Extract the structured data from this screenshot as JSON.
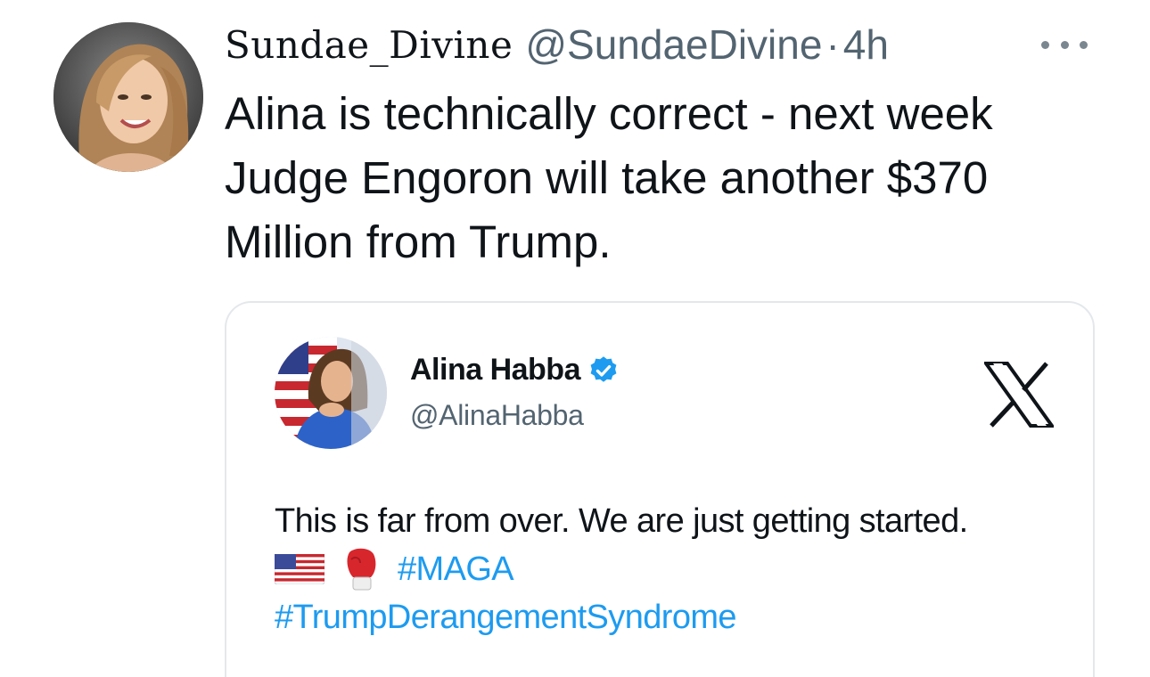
{
  "tweet": {
    "author": {
      "display_name": "Sundae_Divine",
      "handle": "@SundaeDivine",
      "avatar": "profile-photo"
    },
    "separator": "·",
    "time": "4h",
    "more_icon": "more-horizontal-icon",
    "text": "Alina is technically correct - next week Judge Engoron will take another $370 Million from Trump."
  },
  "quoted": {
    "author": {
      "display_name": "Alina Habba",
      "handle": "@AlinaHabba",
      "verified": true,
      "avatar": "profile-photo"
    },
    "brand_icon": "x-logo-icon",
    "text_line1": "This is far from over. We are just getting started.",
    "emoji": [
      "us-flag-emoji",
      "boxing-glove-emoji"
    ],
    "hashtag1": "#MAGA",
    "hashtag2": "#TrumpDerangementSyndrome"
  },
  "colors": {
    "text_primary": "#0f1419",
    "text_secondary": "#536471",
    "link": "#1d9bf0",
    "verified": "#1d9bf0",
    "card_border": "#e4e8eb"
  }
}
